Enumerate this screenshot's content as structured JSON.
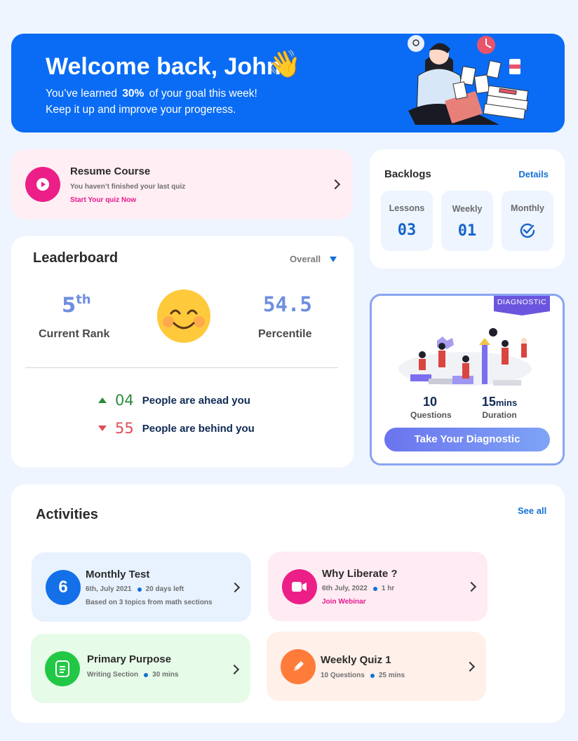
{
  "banner": {
    "welcome": "Welcome back, John",
    "wave": "👋",
    "line1_pre": "You’ve learned",
    "line1_pct": "30%",
    "line1_post": "of your goal this week!",
    "line2": "Keep it up and improve your progeress."
  },
  "resume": {
    "title": "Resume Course",
    "subtitle": "You haven’t finished your last quiz",
    "cta": "Start Your quiz Now"
  },
  "backlogs": {
    "title": "Backlogs",
    "details": "Details",
    "items": [
      {
        "label": "Lessons",
        "value": "03"
      },
      {
        "label": "Weekly",
        "value": "01"
      },
      {
        "label": "Monthly",
        "value": ""
      }
    ]
  },
  "leaderboard": {
    "title": "Leaderboard",
    "filter": "Overall",
    "rank": "5",
    "rank_suffix": "th",
    "rank_label": "Current Rank",
    "percentile": "54.5",
    "percentile_label": "Percentile",
    "ahead_count": "04",
    "ahead_text": "People are ahead you",
    "behind_count": "55",
    "behind_text": "People are behind you",
    "colors": {
      "up": "#2e8b3d",
      "down": "#e04b55"
    }
  },
  "diagnostic": {
    "ribbon": "DIAGNOSTIC",
    "questions": "10",
    "questions_label": "Questions",
    "duration": "15",
    "duration_unit": "mins",
    "duration_label": "Duration",
    "button": "Take Your Diagnostic"
  },
  "activities": {
    "title": "Activities",
    "see_all": "See all",
    "items": [
      {
        "icon_text": "6",
        "title": "Monthly Test",
        "meta1": "6th, July 2021",
        "meta2": "20 days left",
        "extra": "Based on 3 topics from math sections",
        "icon": "number-badge"
      },
      {
        "title": "Why Liberate ?",
        "meta1": "6th July, 2022",
        "meta2": "1 hr",
        "extra": "Join Webinar",
        "icon": "video-icon"
      },
      {
        "title": "Primary Purpose",
        "meta1": "Writing Section",
        "meta2": "30 mins",
        "icon": "document-icon"
      },
      {
        "title": "Weekly Quiz  1",
        "meta1": "10 Questions",
        "meta2": "25 mins",
        "icon": "pencil-icon"
      }
    ]
  }
}
